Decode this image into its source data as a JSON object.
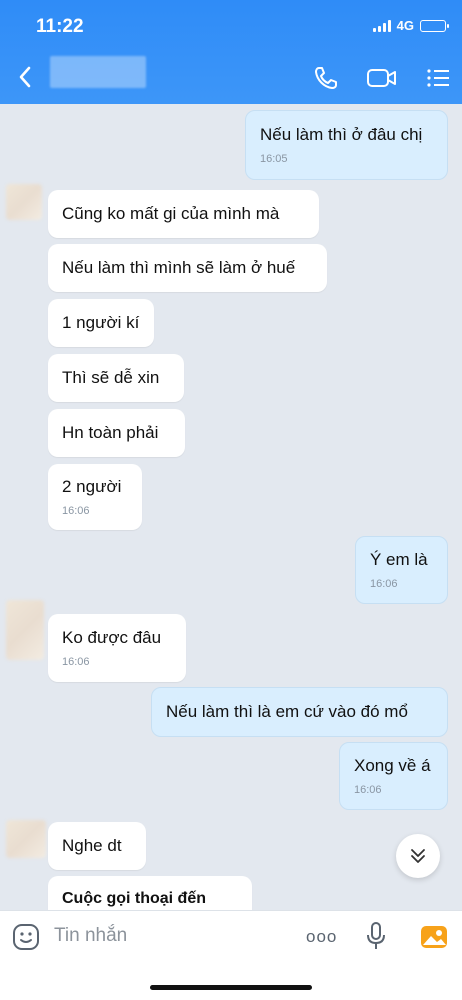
{
  "status_bar": {
    "time": "11:22",
    "network": "4G"
  },
  "header": {
    "back_icon": "chevron-left-icon",
    "contact_name": "",
    "icons": [
      "phone-icon",
      "video-icon",
      "menu-icon"
    ]
  },
  "messages": [
    {
      "text": "Nếu làm thì ở đâu chị",
      "time": "16:05"
    },
    {
      "text": "Cũng ko mất gi của mình mà"
    },
    {
      "text": "Nếu làm thì mình sẽ làm ở huế"
    },
    {
      "text": "1 người kí"
    },
    {
      "text": "Thì sẽ dễ xin"
    },
    {
      "text": "Hn toàn phải"
    },
    {
      "text": "2 người",
      "time": "16:06"
    },
    {
      "text": "Ý em là",
      "time": "16:06"
    },
    {
      "text": "Ko được đâu",
      "time": "16:06"
    },
    {
      "text": "Nếu làm thì là em cứ vào đó mổ"
    },
    {
      "text": "Xong về á",
      "time": "16:06"
    },
    {
      "text": "Nghe dt"
    },
    {
      "text": "Cuộc gọi thoại đến"
    }
  ],
  "input": {
    "placeholder": "Tin nhắn",
    "more_label": "ooo"
  },
  "colors": {
    "header": "#2f8cf7",
    "incoming": "#ffffff",
    "outgoing": "#d9eefe",
    "background": "#e3e8ef"
  }
}
